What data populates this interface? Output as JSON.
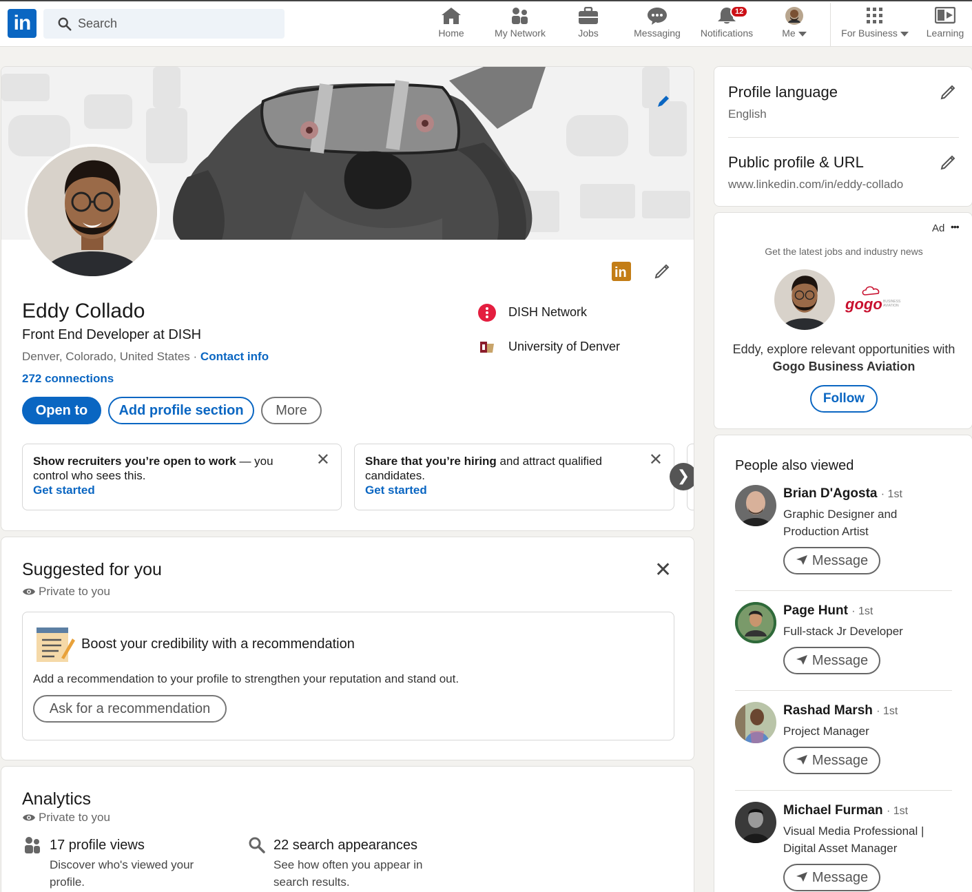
{
  "nav": {
    "search_placeholder": "Search",
    "items": [
      {
        "label": "Home",
        "icon": "home-icon"
      },
      {
        "label": "My Network",
        "icon": "network-icon"
      },
      {
        "label": "Jobs",
        "icon": "briefcase-icon"
      },
      {
        "label": "Messaging",
        "icon": "messaging-icon"
      },
      {
        "label": "Notifications",
        "icon": "bell-icon",
        "badge": "12"
      },
      {
        "label": "Me",
        "icon": "avatar"
      },
      {
        "label": "For Business",
        "icon": "grid-icon"
      },
      {
        "label": "Learning",
        "icon": "learning-icon"
      }
    ],
    "logo_text": "in"
  },
  "profile": {
    "name": "Eddy Collado",
    "headline": "Front End Developer at DISH",
    "location": "Denver, Colorado, United States",
    "location_sep": " · ",
    "contact_info": "Contact info",
    "connections": "272 connections",
    "buttons": {
      "open_to": "Open to",
      "add_section": "Add profile section",
      "more": "More"
    },
    "experience": [
      {
        "label": "DISH Network"
      },
      {
        "label": "University of Denver"
      }
    ],
    "cards": [
      {
        "bold": "Show recruiters you’re open to work",
        "rest": " — you control who sees this.",
        "action": "Get started"
      },
      {
        "bold": "Share that you’re hiring",
        "rest": " and attract qualified candidates.",
        "action": "Get started"
      }
    ]
  },
  "suggested": {
    "title": "Suggested for you",
    "private": "Private to you",
    "box_title": "Boost your credibility with a recommendation",
    "box_text": "Add a recommendation to your profile to strengthen your reputation and stand out.",
    "box_button": "Ask for a recommendation"
  },
  "analytics": {
    "title": "Analytics",
    "private": "Private to you",
    "items": [
      {
        "title": "17 profile views",
        "desc": "Discover who's viewed your profile."
      },
      {
        "title": "22 search appearances",
        "desc": "See how often you appear in search results."
      }
    ]
  },
  "sidebar": {
    "language_title": "Profile language",
    "language_value": "English",
    "url_title": "Public profile & URL",
    "url_value": "www.linkedin.com/in/eddy-collado"
  },
  "ad": {
    "label": "Ad",
    "more": "•••",
    "tagline": "Get the latest jobs and industry news",
    "text": "Eddy, explore relevant opportunities with",
    "company": "Gogo Business Aviation",
    "logo_text": "gogo",
    "logo_sub": "BUSINESS AVIATION",
    "button": "Follow"
  },
  "people": {
    "title": "People also viewed",
    "message_label": "Message",
    "list": [
      {
        "name": "Brian D'Agosta",
        "degree": "· 1st",
        "title": "Graphic Designer and Production Artist"
      },
      {
        "name": "Page Hunt",
        "degree": "· 1st",
        "title": "Full-stack Jr Developer"
      },
      {
        "name": "Rashad Marsh",
        "degree": "· 1st",
        "title": "Project Manager"
      },
      {
        "name": "Michael Furman",
        "degree": "· 1st",
        "title": "Visual Media Professional | Digital Asset Manager"
      }
    ]
  },
  "colors": {
    "brand": "#0a66c2",
    "badge": "#cc1016",
    "edit_gold": "#c37d16"
  }
}
